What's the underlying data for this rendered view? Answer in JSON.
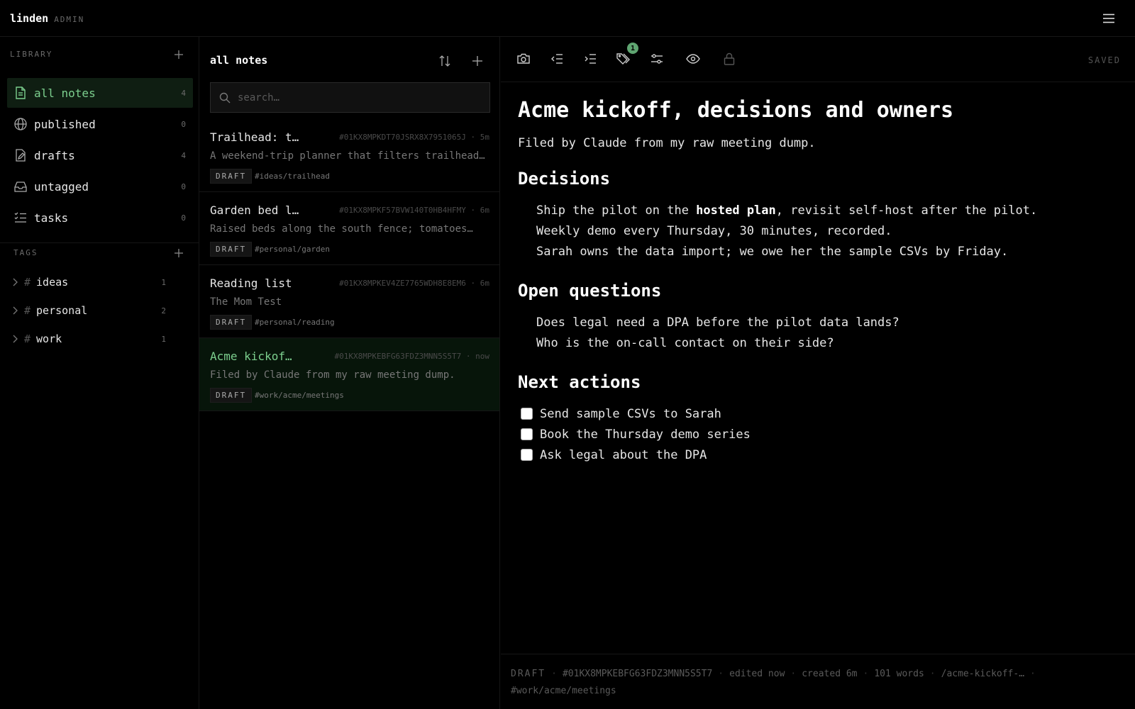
{
  "app": {
    "brand": "linden",
    "brand_sub": "ADMIN"
  },
  "sidebar": {
    "library_title": "LIBRARY",
    "items": [
      {
        "label": "all notes",
        "count": "4",
        "icon": "file-text-icon",
        "active": true
      },
      {
        "label": "published",
        "count": "0",
        "icon": "globe-icon"
      },
      {
        "label": "drafts",
        "count": "4",
        "icon": "draft-icon"
      },
      {
        "label": "untagged",
        "count": "0",
        "icon": "inbox-icon"
      },
      {
        "label": "tasks",
        "count": "0",
        "icon": "list-checks-icon"
      }
    ],
    "tags_title": "TAGS",
    "tags": [
      {
        "label": "ideas",
        "count": "1"
      },
      {
        "label": "personal",
        "count": "2"
      },
      {
        "label": "work",
        "count": "1"
      }
    ]
  },
  "notes": {
    "title": "all notes",
    "search_placeholder": "search…",
    "items": [
      {
        "title": "Trailhead: t…",
        "meta": "#01KX8MPKDT70JSRX8X7951065J · 5m",
        "snippet": "A weekend-trip planner that filters trailhead…",
        "badge": "DRAFT",
        "tag": "#ideas/trailhead"
      },
      {
        "title": "Garden bed l…",
        "meta": "#01KX8MPKF57BVW140T0HB4HFMY · 6m",
        "snippet": "Raised beds along the south fence; tomatoes…",
        "badge": "DRAFT",
        "tag": "#personal/garden"
      },
      {
        "title": "Reading list",
        "meta": "#01KX8MPKEV4ZE7765WDH8E8EM6 · 6m",
        "snippet": "The Mom Test",
        "badge": "DRAFT",
        "tag": "#personal/reading"
      },
      {
        "title": "Acme kickof…",
        "meta": "#01KX8MPKEBFG63FDZ3MNN5S5T7 · now",
        "snippet": "Filed by Claude from my raw meeting dump.",
        "badge": "DRAFT",
        "tag": "#work/acme/meetings",
        "active": true
      }
    ]
  },
  "editor": {
    "tag_badge_count": "1",
    "saved_label": "SAVED",
    "title": "Acme kickoff, decisions and owners",
    "lead": "Filed by Claude from my raw meeting dump.",
    "decisions_heading": "Decisions",
    "decision_1_pre": "Ship the pilot on the ",
    "decision_1_bold": "hosted plan",
    "decision_1_post": ", revisit self-host after the pilot.",
    "decision_2": "Weekly demo every Thursday, 30 minutes, recorded.",
    "decision_3": "Sarah owns the data import; we owe her the sample CSVs by Friday.",
    "questions_heading": "Open questions",
    "question_1": "Does legal need a DPA before the pilot data lands?",
    "question_2": "Who is the on-call contact on their side?",
    "actions_heading": "Next actions",
    "actions": [
      "Send sample CSVs to Sarah",
      "Book the Thursday demo series",
      "Ask legal about the DPA"
    ]
  },
  "statusbar": {
    "status": "DRAFT",
    "id": "#01KX8MPKEBFG63FDZ3MNN5S5T7",
    "edited": "edited now",
    "created": "created 6m",
    "words": "101 words",
    "slug": "/acme-kickoff-…",
    "tag": "#work/acme/meetings"
  }
}
